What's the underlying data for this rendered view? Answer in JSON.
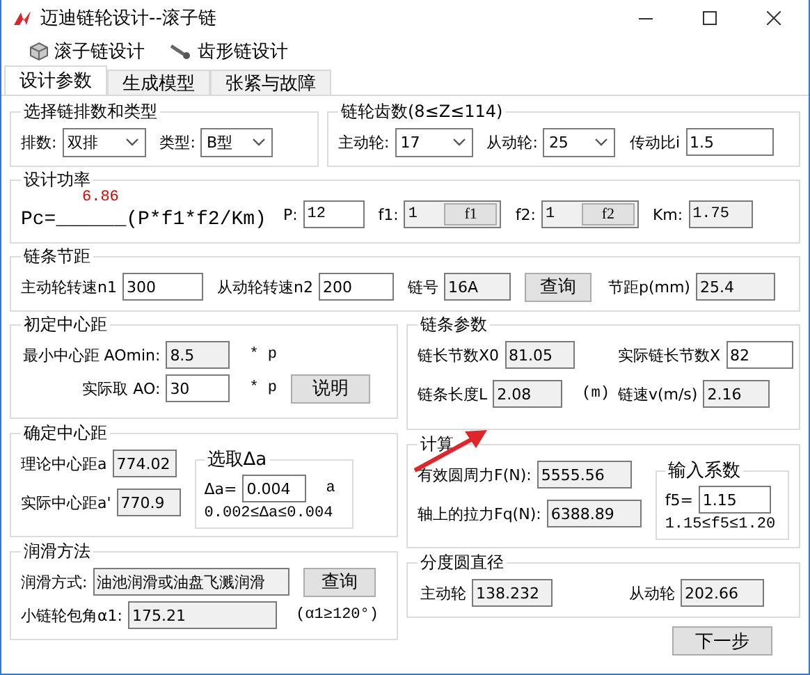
{
  "window": {
    "title": "迈迪链轮设计--滚子链"
  },
  "menu": [
    {
      "label": "滚子链设计"
    },
    {
      "label": "齿形链设计"
    }
  ],
  "tabs": [
    {
      "label": "设计参数",
      "selected": true
    },
    {
      "label": "生成模型",
      "selected": false
    },
    {
      "label": "张紧与故障",
      "selected": false
    }
  ],
  "chain_type": {
    "title": "选择链排数和类型",
    "rows": {
      "label": "排数:",
      "value": "双排"
    },
    "type": {
      "label": "类型:",
      "value": "B型"
    }
  },
  "teeth": {
    "title": "链轮齿数(8≤Z≤114)",
    "driving": {
      "label": "主动轮:",
      "value": "17"
    },
    "driven": {
      "label": "从动轮:",
      "value": "25"
    },
    "ratio": {
      "label": "传动比i",
      "value": "1.5",
      "readonly": false
    }
  },
  "power": {
    "title": "设计功率",
    "formula": "Pc=______(P*f1*f2/Km)",
    "result": "6.86",
    "p": {
      "label": "P:",
      "value": "12",
      "readonly": false
    },
    "f1": {
      "label": "f1:",
      "value": "1",
      "button": "f1",
      "readonly": true
    },
    "f2": {
      "label": "f2:",
      "value": "1",
      "button": "f2",
      "readonly": true
    },
    "km": {
      "label": "Km:",
      "value": "1.75",
      "readonly": true
    }
  },
  "pitch": {
    "title": "链条节距",
    "n1": {
      "label": "主动轮转速n1",
      "value": "300",
      "readonly": false
    },
    "n2": {
      "label": "从动轮转速n2",
      "value": "200",
      "readonly": false
    },
    "chain_no": {
      "label": "链号",
      "value": "16A",
      "readonly": true
    },
    "query_button": "查询",
    "p": {
      "label": "节距p(mm)",
      "value": "25.4",
      "readonly": true
    }
  },
  "initial_distance": {
    "title": "初定中心距",
    "min": {
      "label": "最小中心距 AOmin:",
      "value": "8.5",
      "unit": "* p",
      "readonly": true
    },
    "actual": {
      "label": "实际取 AO:",
      "value": "30",
      "unit": "* p",
      "readonly": false
    },
    "help_button": "说明"
  },
  "chain_params": {
    "title": "链条参数",
    "x0": {
      "label": "链长节数X0",
      "value": "81.05",
      "readonly": true
    },
    "x": {
      "label": "实际链长节数X",
      "value": "82",
      "readonly": false
    },
    "length": {
      "label": "链条长度L",
      "value": "2.08",
      "unit": "(m)",
      "readonly": true
    },
    "speed": {
      "label": "链速v(m/s)",
      "value": "2.16",
      "readonly": true
    }
  },
  "final_distance": {
    "title": "确定中心距",
    "theory": {
      "label": "理论中心距a",
      "value": "774.02",
      "readonly": true
    },
    "actual": {
      "label": "实际中心距a'",
      "value": "770.9",
      "readonly": true
    },
    "delta": {
      "title": "选取Δa",
      "field": {
        "label": "Δa=",
        "value": "0.004",
        "unit": "a",
        "readonly": false
      },
      "range": "0.002≤Δa≤0.004"
    }
  },
  "calc": {
    "title": "计算",
    "force": {
      "label": "有效圆周力F(N):",
      "value": "5555.56",
      "readonly": true
    },
    "shaft": {
      "label": "轴上的拉力Fq(N):",
      "value": "6388.89",
      "readonly": true
    },
    "coef": {
      "title": "输入系数",
      "field": {
        "label": "f5=",
        "value": "1.15",
        "readonly": false
      },
      "range": "1.15≤f5≤1.20"
    }
  },
  "lubrication": {
    "title": "润滑方法",
    "method": {
      "label": "润滑方式:",
      "value": "油池润滑或油盘飞溅润滑",
      "readonly": true
    },
    "query_button": "查询",
    "angle": {
      "label": "小链轮包角α1:",
      "value": "175.21",
      "unit": "(α1≥120°)",
      "readonly": true
    }
  },
  "pitch_diameter": {
    "title": "分度圆直径",
    "driving": {
      "label": "主动轮",
      "value": "138.232",
      "readonly": true
    },
    "driven": {
      "label": "从动轮",
      "value": "202.66",
      "readonly": true
    }
  },
  "next_button": "下一步"
}
